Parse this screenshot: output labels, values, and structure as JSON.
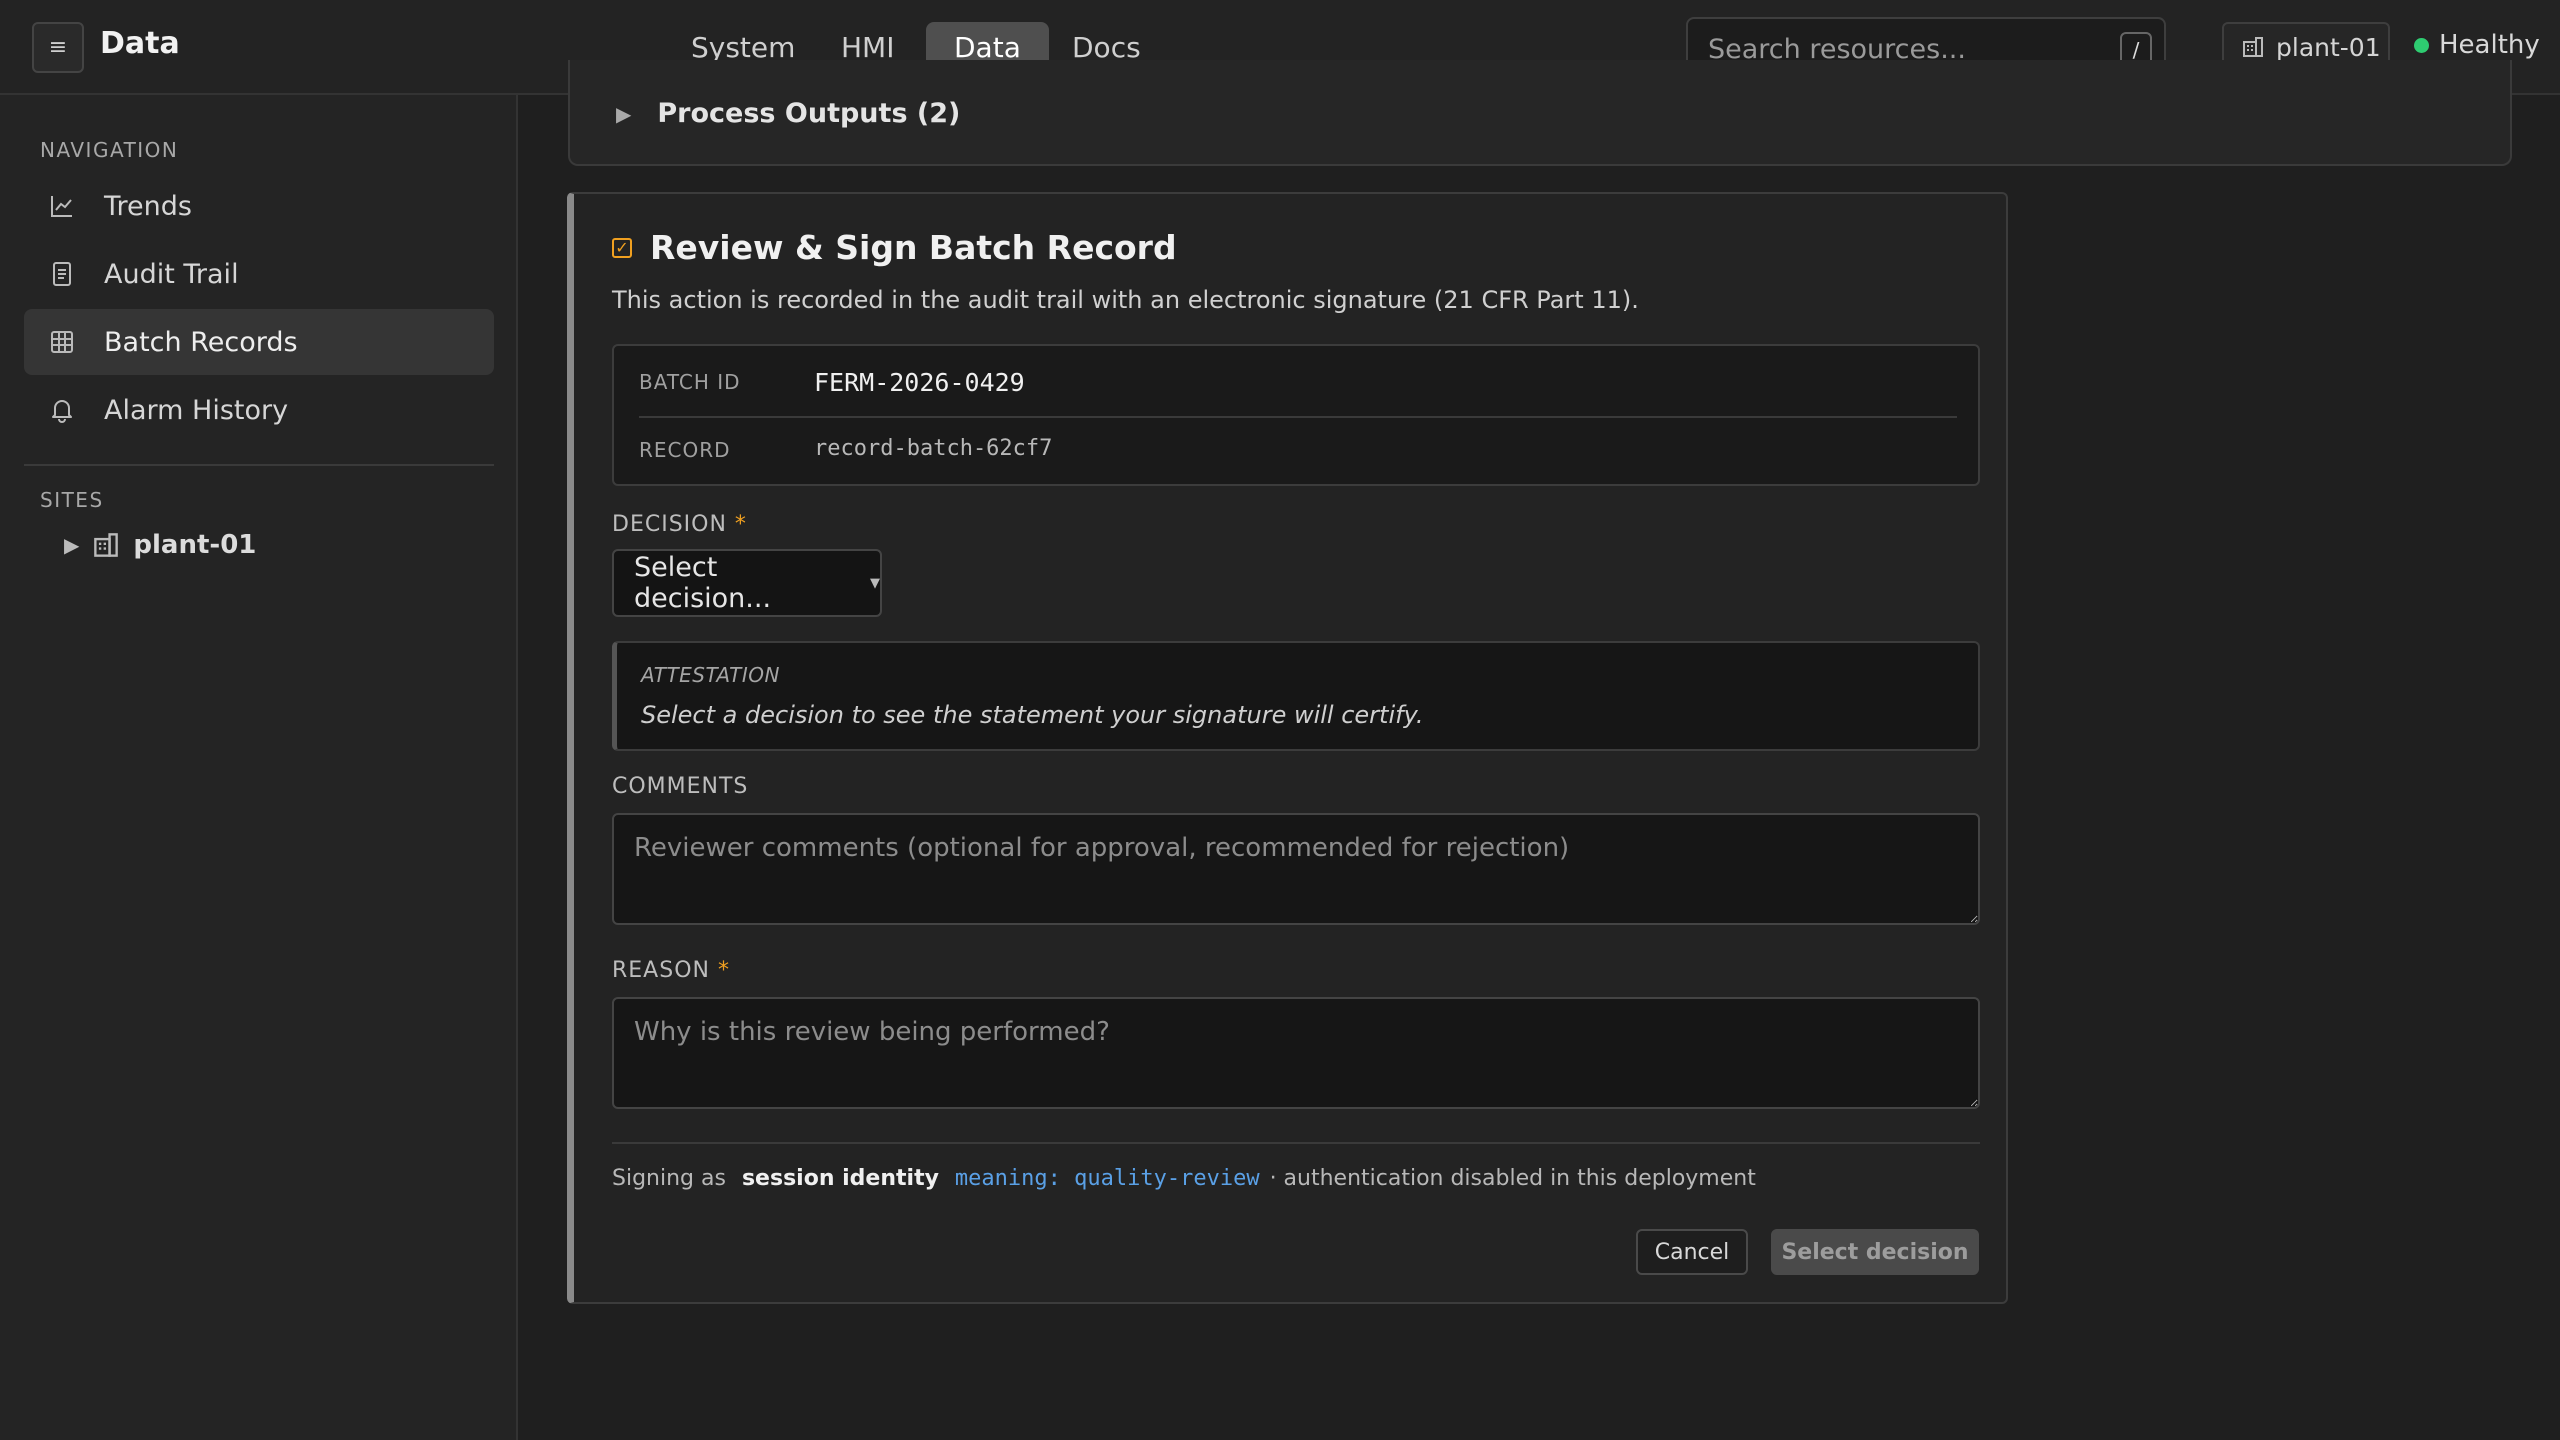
{
  "topbar": {
    "app_title": "Data",
    "menu_icon": "hamburger-icon",
    "tabs": [
      {
        "label": "System",
        "active": false
      },
      {
        "label": "HMI",
        "active": false
      },
      {
        "label": "Data",
        "active": true
      },
      {
        "label": "Docs",
        "active": false
      }
    ],
    "search": {
      "placeholder": "Search resources...",
      "shortcut": "/"
    },
    "site": {
      "icon": "building-icon",
      "label": "plant-01"
    },
    "status": {
      "label": "Healthy",
      "color": "#2ecc71"
    }
  },
  "sidebar": {
    "nav_heading": "NAVIGATION",
    "items": [
      {
        "label": "Trends",
        "icon": "chart-line-icon",
        "active": false
      },
      {
        "label": "Audit Trail",
        "icon": "document-icon",
        "active": false
      },
      {
        "label": "Batch Records",
        "icon": "table-icon",
        "active": true
      },
      {
        "label": "Alarm History",
        "icon": "bell-icon",
        "active": false
      }
    ],
    "sites_heading": "SITES",
    "tree": [
      {
        "label": "plant-01",
        "icon": "building-icon",
        "expanded": false
      }
    ]
  },
  "main": {
    "outputs_section": {
      "label": "Process Outputs (2)",
      "expanded": false
    },
    "review": {
      "title": "Review & Sign Batch Record",
      "description": "This action is recorded in the audit trail with an electronic signature (21 CFR Part 11).",
      "batch_id_label": "BATCH ID",
      "batch_id": "FERM-2026-0429",
      "record_label": "RECORD",
      "record": "record-batch-62cf7",
      "decision_label": "DECISION",
      "required_mark": "*",
      "decision_placeholder": "Select decision...",
      "attestation_label": "ATTESTATION",
      "attestation_text": "Select a decision to see the statement your signature will certify.",
      "comments_label": "COMMENTS",
      "comments_placeholder": "Reviewer comments (optional for approval, recommended for rejection)",
      "reason_label": "REASON",
      "reason_placeholder": "Why is this review being performed?",
      "signing_prefix": "Signing as",
      "signing_identity": "session identity",
      "signing_meaning": "meaning: quality-review",
      "signing_note": "· authentication disabled in this deployment",
      "cancel_label": "Cancel",
      "submit_label": "Select decision",
      "accent_color": "#f0a020"
    }
  }
}
